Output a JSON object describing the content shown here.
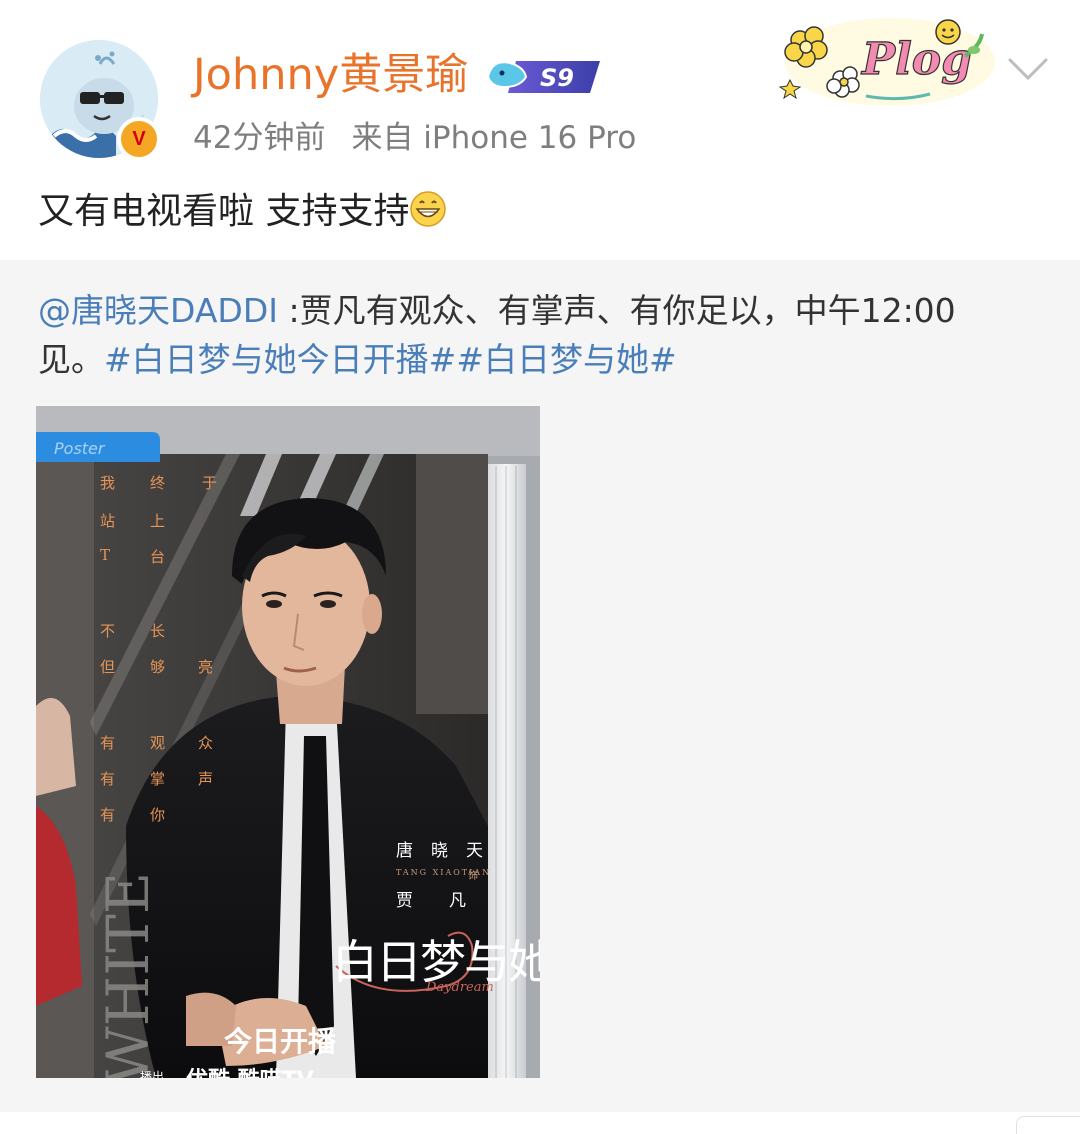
{
  "post": {
    "username": "Johnny黄景瑜",
    "vip_level": "S9",
    "time": "42分钟前",
    "source": "来自 iPhone 16 Pro",
    "decoration_label": "Plog",
    "text": "又有电视看啦 支持支持",
    "emoji": "grinning-face-icon"
  },
  "repost": {
    "mention": "@唐晓天DADDI",
    "text_line1_rest": " :贾凡有观众、有掌声、有你足以，中午12:00",
    "text_line2_prefix": "见。",
    "hashtag1": "#白日梦与她今日开播#",
    "hashtag2": "#白日梦与她#"
  },
  "poster": {
    "tag": "Poster",
    "vertical_text": [
      "我",
      "终",
      "于",
      "站",
      "上",
      "T",
      "台",
      "不",
      "长",
      "但",
      "够",
      "亮",
      "有",
      "观",
      "众",
      "有",
      "掌",
      "声",
      "有",
      "你"
    ],
    "actor_name": "唐晓天",
    "actor_pinyin": "TANG XIAOTIAN",
    "role_label": "饰",
    "role_name": "贾凡",
    "title": "白日梦与她",
    "title_script": "Daydream",
    "premiere": "今日开播",
    "platform_label": "播出",
    "platforms": "优酷  酷喵TV",
    "side_text": "WHITE"
  },
  "colors": {
    "username": "#e8742c",
    "link": "#4a7eb8",
    "meta": "#7e7e7e",
    "repost_bg": "#f5f5f5",
    "verified_badge": "#f5a623"
  }
}
